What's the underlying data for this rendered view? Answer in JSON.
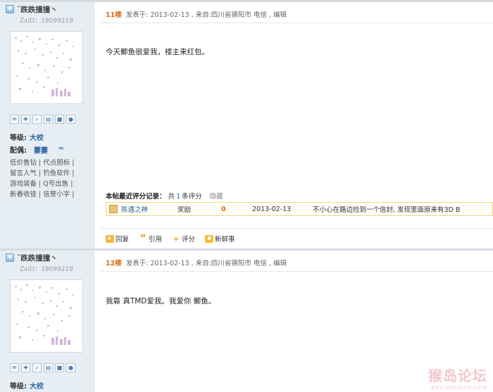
{
  "posts": [
    {
      "user": {
        "name": "˘跌跌撞撞丶",
        "zxid": "ZxID：19099219",
        "level_label": "等级:",
        "level_value": "大校",
        "spouse_label": "配偶:",
        "spouse_value": "萋萋",
        "spouse_mark": "≈",
        "links": [
          "低价售钻 | 代点图标 |",
          "留言人气 | 钓鱼软件 |",
          "游戏装备 | Q号出售 |",
          "新春收徒 | 信誉小字 |"
        ]
      },
      "floor": "11楼",
      "meta": "发表于: 2013-02-13 , 来自:四川省德阳市  电信 , 编辑",
      "content": "今天鲫鱼很爱我，楼主来红包。",
      "rating": {
        "title_bold": "本帖最近评分记录：",
        "title_pre": "共",
        "count": "1",
        "title_post": "条评分",
        "hide": "隐藏",
        "row": {
          "rater": "陈遇之神",
          "type": "奖励",
          "points": "0",
          "date": "2013-02-13",
          "reason": "不小心在路边捡到一个信封, 发现里面原来有3D B"
        }
      },
      "actions": [
        "回复",
        "引用",
        "评分",
        "新鲜事"
      ]
    },
    {
      "user": {
        "name": "˘跌跌撞撞丶",
        "zxid": "ZxID：19099219",
        "level_label": "等级:",
        "level_value": "大校"
      },
      "floor": "12楼",
      "meta": "发表于: 2013-02-13 , 来自:四川省德阳市  电信 , 编辑",
      "content": "我靠   真TMD爱我。我爱你  鲫鱼。"
    }
  ],
  "watermark": {
    "main": "猴岛论坛",
    "sub": "BBS.HOUDAO.COM"
  },
  "icons": [
    "mail-icon",
    "add-friend-icon",
    "search-icon",
    "profile-icon",
    "gift-icon",
    "qq-icon"
  ]
}
